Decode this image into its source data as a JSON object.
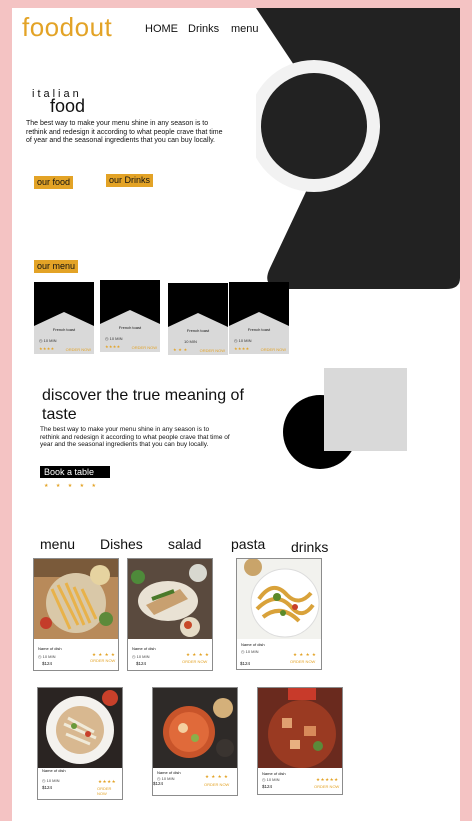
{
  "brand": {
    "logo": "foodout"
  },
  "nav": {
    "home": "HOME",
    "drinks": "Drinks",
    "menu": "menu"
  },
  "hero": {
    "kicker": "italian",
    "title": "food",
    "text": "The best way to make your menu shine in any season is to rethink and redesign it according to what people crave that time of year and the seasonal ingredients that you can buy locally.",
    "btn_food": "our food",
    "btn_drinks": "our Drinks"
  },
  "our_menu": {
    "label": "our menu",
    "cards": [
      {
        "name": "French toast",
        "time": "10 MIN",
        "stars": "★★★★",
        "order": "ORDER NOW"
      },
      {
        "name": "French toast",
        "time": "10 MIN",
        "stars": "★★★★",
        "order": "ORDER NOW"
      },
      {
        "name": "French toast",
        "time": "10 MIN",
        "stars": "★ ★ ★",
        "order": "ORDER NOW"
      },
      {
        "name": "French toast",
        "time": "10 MIN",
        "stars": "★★★★",
        "order": "ORDER NOW"
      }
    ]
  },
  "discover": {
    "title": "discover the true meaning of taste",
    "text": "The best way to make your menu shine in any season is to rethink and redesign it according to what people crave that time of year and the seasonal ingredients that you can buy locally.",
    "book": "Book a table",
    "rating": "★ ★ ★ ★ ★"
  },
  "categories": [
    "menu",
    "Dishes",
    "salad",
    "pasta",
    "drinks"
  ],
  "dishes": [
    {
      "name": "Name of dish",
      "time": "10 MIN",
      "price": "$124",
      "stars": "★ ★ ★ ★",
      "order": "ORDER NOW"
    },
    {
      "name": "Name of dish",
      "time": "10 MIN",
      "price": "$124",
      "stars": "★ ★ ★ ★",
      "order": "ORDER NOW"
    },
    {
      "name": "Name of dish",
      "time": "10 MIN",
      "price": "$124",
      "stars": "★ ★ ★ ★",
      "order": "ORDER NOW"
    },
    {
      "name": "Name of dish",
      "time": "10 MIN",
      "price": "$124",
      "stars": "★★★★",
      "order": "ORDER NOW"
    },
    {
      "name": "Name of dish",
      "time": "10 MIN",
      "price": "$124",
      "stars": "★ ★ ★ ★",
      "order": "ORDER NOW"
    },
    {
      "name": "Name of dish",
      "time": "10 MIN",
      "price": "$124",
      "stars": "★★★★★",
      "order": "ORDER NOW"
    }
  ],
  "colors": {
    "accent": "#e3a326",
    "dark": "#222222",
    "frame": "#f4c3c3",
    "card": "#d9d9d9"
  }
}
